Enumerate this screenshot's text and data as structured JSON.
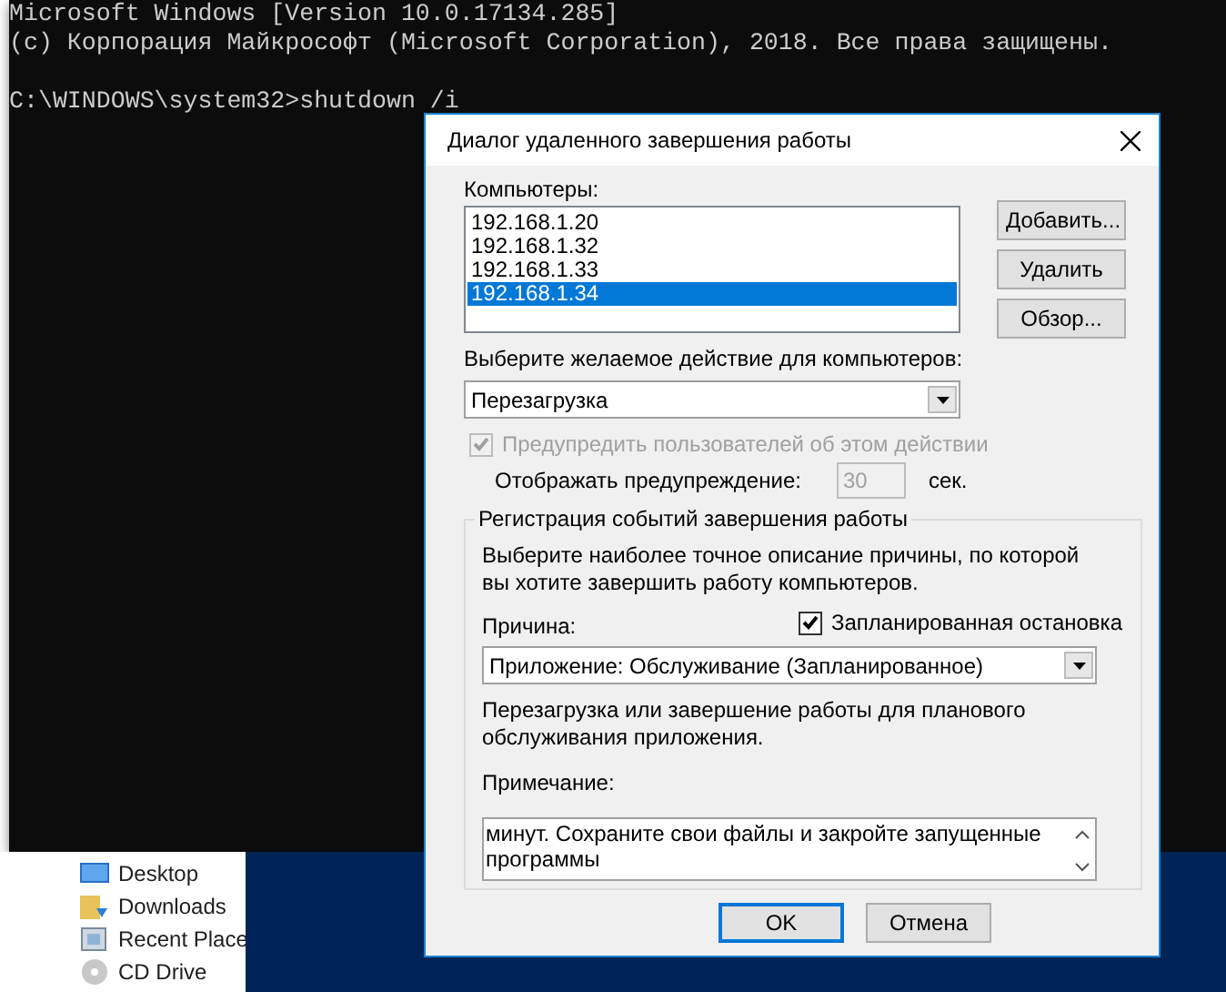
{
  "console": {
    "lines": [
      "Microsoft Windows [Version 10.0.17134.285]",
      "(c) Корпорация Майкрософт (Microsoft Corporation), 2018. Все права защищены."
    ],
    "prompt": "C:\\WINDOWS\\system32>shutdown /i"
  },
  "explorer": {
    "items": [
      {
        "label": "Desktop",
        "kind": "desktop"
      },
      {
        "label": "Downloads",
        "kind": "downloads"
      },
      {
        "label": "Recent Place",
        "kind": "recent"
      },
      {
        "label": "CD Drive",
        "kind": "drive"
      }
    ]
  },
  "dialog": {
    "title": "Диалог удаленного завершения работы",
    "computers_label": "Компьютеры:",
    "computers": [
      {
        "address": "192.168.1.20",
        "selected": false
      },
      {
        "address": "192.168.1.32",
        "selected": false
      },
      {
        "address": "192.168.1.33",
        "selected": false
      },
      {
        "address": "192.168.1.34",
        "selected": true
      }
    ],
    "side_buttons": [
      "Добавить...",
      "Удалить",
      "Обзор..."
    ],
    "action_label": "Выберите желаемое действие для компьютеров:",
    "action_value": "Перезагрузка",
    "warn": {
      "label": "Предупредить пользователей об этом действии",
      "checked": true,
      "disabled": true
    },
    "display_warning": {
      "label": "Отображать предупреждение:",
      "value": "30",
      "unit": "сек.",
      "disabled": true
    },
    "group": {
      "title": "Регистрация событий завершения работы",
      "instructions": "Выберите наиболее точное описание причины, по которой вы хотите завершить работу компьютеров.",
      "reason_label": "Причина:",
      "planned": {
        "label": "Запланированная остановка",
        "checked": true
      },
      "reason_value": "Приложение: Обслуживание (Запланированное)",
      "reason_description": "Перезагрузка или завершение работы для планового обслуживания приложения.",
      "comment_label": "Примечание:",
      "comment_value": "минут. Сохраните свои файлы и закройте запущенные программы"
    },
    "footer_buttons": [
      {
        "label": "OK",
        "default": true
      },
      {
        "label": "Отмена",
        "default": false
      }
    ]
  }
}
